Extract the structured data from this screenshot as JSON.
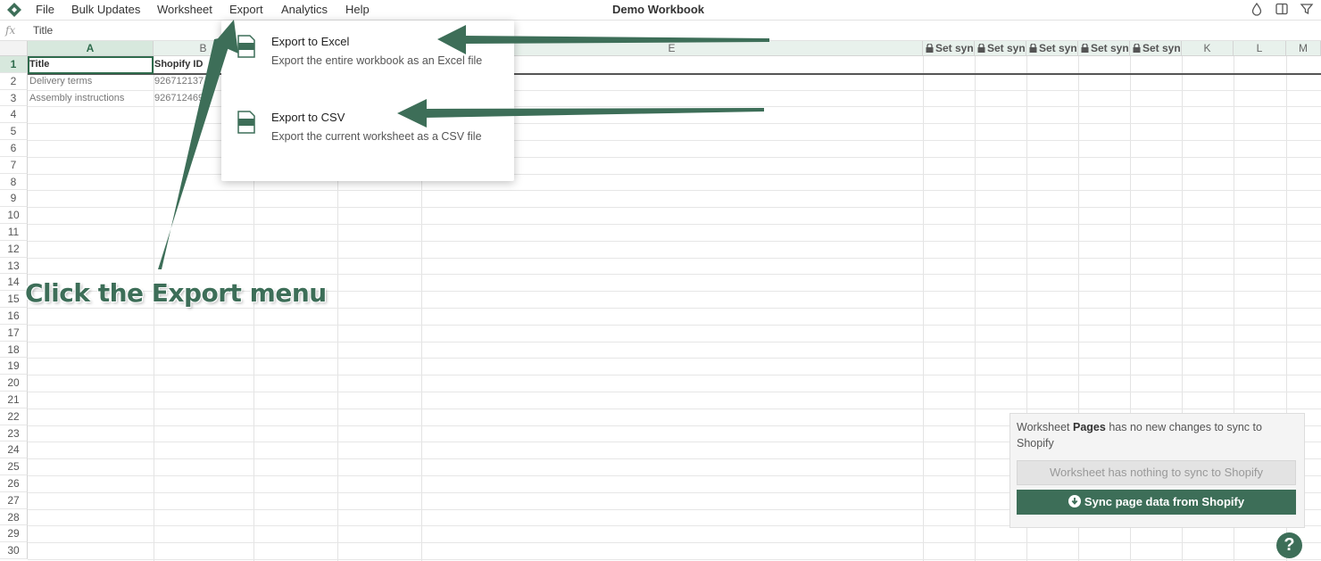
{
  "menubar": {
    "items": [
      "File",
      "Bulk Updates",
      "Worksheet",
      "Export",
      "Analytics",
      "Help"
    ],
    "title": "Demo Workbook",
    "icons": [
      "drop-icon",
      "panel-icon",
      "filter-icon"
    ]
  },
  "formula_bar": {
    "fx_label": "fx",
    "value": "Title"
  },
  "grid": {
    "columns": [
      "A",
      "B",
      "",
      "",
      "E",
      "Set syn",
      "Set syn",
      "Set syn",
      "Set syn",
      "Set syn",
      "K",
      "L",
      "M"
    ],
    "rows": [
      "1",
      "2",
      "3",
      "4",
      "5",
      "6",
      "7",
      "8",
      "9",
      "10",
      "11",
      "12",
      "13",
      "14",
      "15",
      "16",
      "17",
      "18",
      "19",
      "20",
      "21",
      "22",
      "23",
      "24",
      "25",
      "26",
      "27",
      "28",
      "29",
      "30"
    ],
    "cells": {
      "A1": "Title",
      "B1": "Shopify ID",
      "A2": "Delivery terms",
      "B2": "926712137",
      "A3": "Assembly instructions",
      "B3": "926712469"
    }
  },
  "export_menu": {
    "items": [
      {
        "title": "Export to Excel",
        "desc": "Export the entire workbook as an Excel file",
        "icon_label": "XLSX"
      },
      {
        "title": "Export to CSV",
        "desc": "Export the current worksheet as a CSV file",
        "icon_label": "CSV"
      }
    ]
  },
  "annotation": {
    "text": "Click the Export menu"
  },
  "sync_panel": {
    "message_pre": "Worksheet ",
    "message_bold": "Pages",
    "message_post": " has no new changes to sync to Shopify",
    "disabled_label": "Worksheet has nothing to sync to Shopify",
    "sync_label": "Sync page data from Shopify"
  },
  "help": {
    "label": "?"
  },
  "colors": {
    "accent": "#3d6e58",
    "header_bg": "#e8f1ec"
  }
}
